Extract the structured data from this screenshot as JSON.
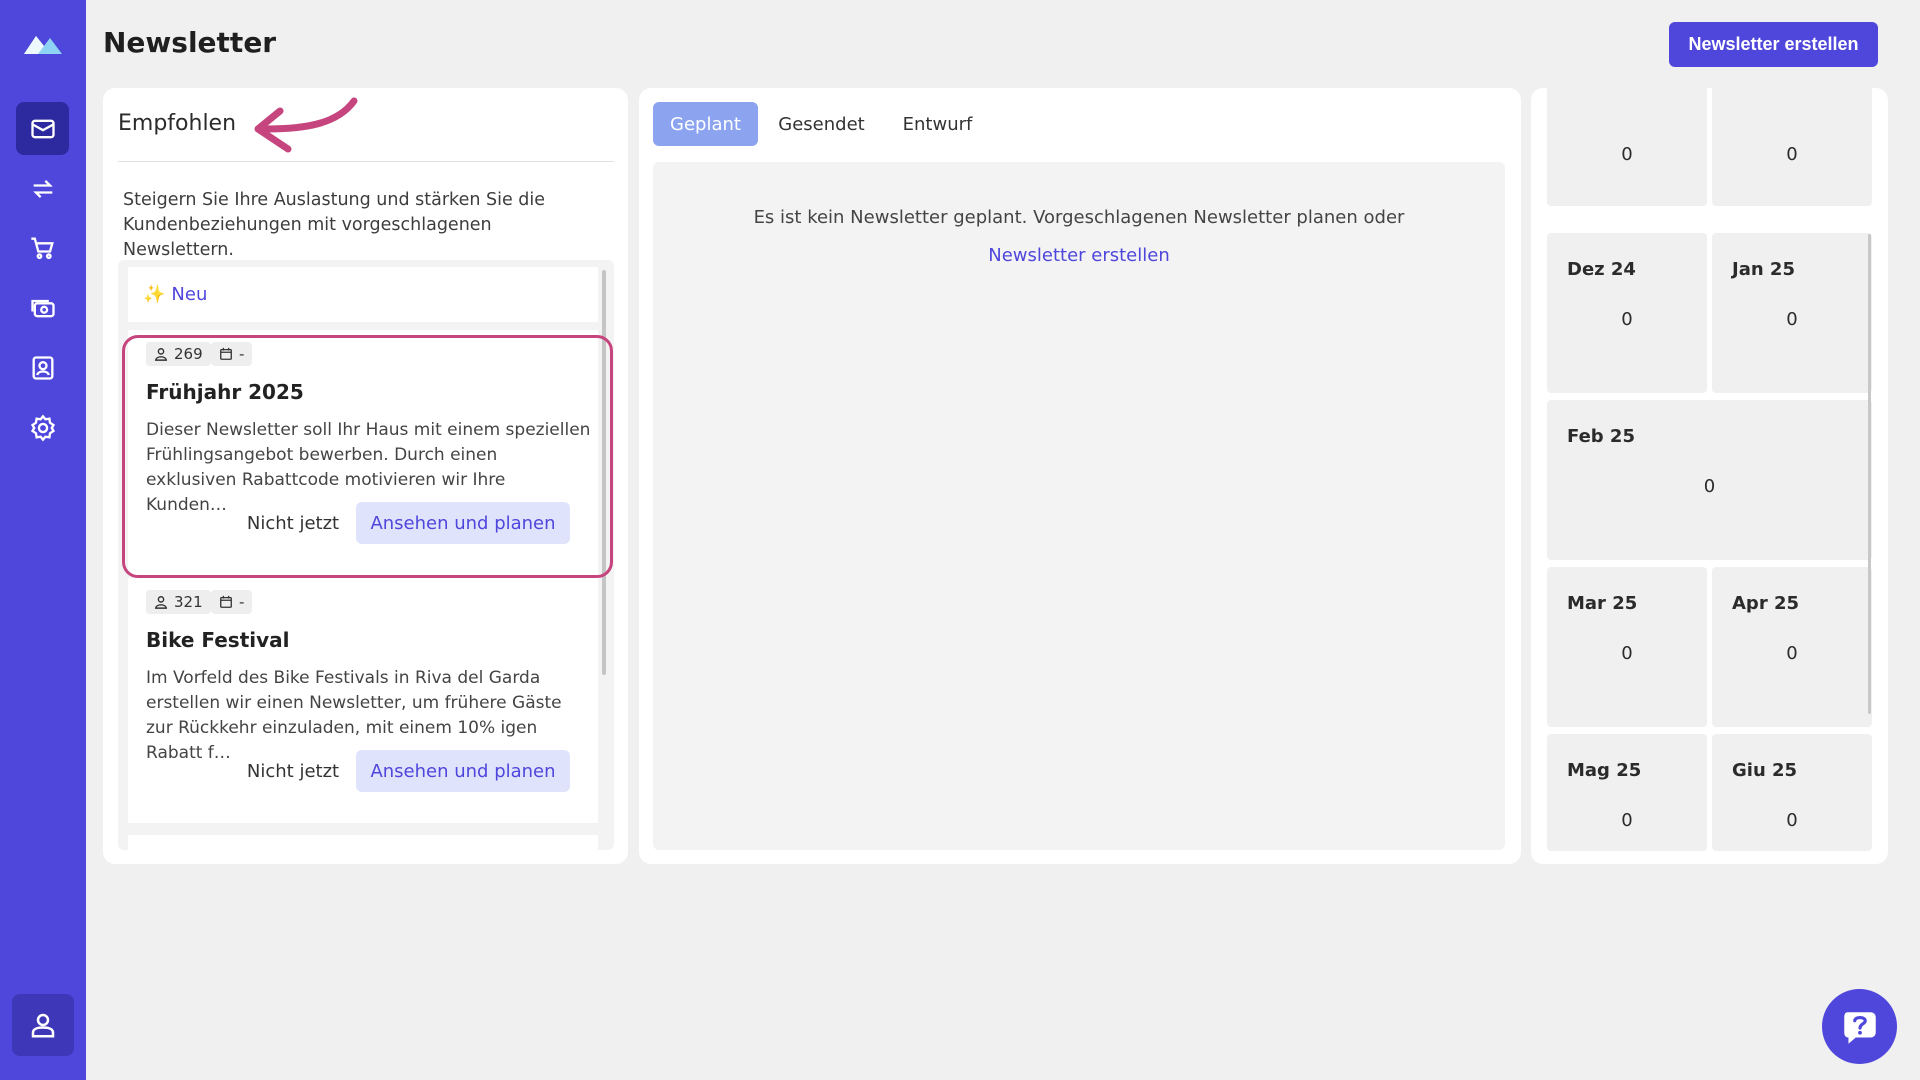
{
  "page": {
    "title": "Newsletter",
    "create_button": "Newsletter erstellen"
  },
  "sidebar": {
    "items": [
      {
        "icon": "mail-icon",
        "active": true
      },
      {
        "icon": "sync-icon",
        "active": false
      },
      {
        "icon": "cart-icon",
        "active": false
      },
      {
        "icon": "money-icon",
        "active": false
      },
      {
        "icon": "contact-icon",
        "active": false
      },
      {
        "icon": "settings-icon",
        "active": false
      }
    ],
    "user_icon": "user-icon"
  },
  "recommended": {
    "title": "Empfohlen",
    "description": "Steigern Sie Ihre Auslastung und stärken Sie die Kundenbeziehungen mit vorgeschlagenen Newslettern.",
    "new_label": "Neu",
    "cards": [
      {
        "recipients": "269",
        "date": "-",
        "title": "Frühjahr 2025",
        "text": "Dieser Newsletter soll Ihr Haus mit einem speziellen Frühlingsangebot bewerben. Durch einen exklusiven Rabattcode motivieren wir Ihre Kunden…",
        "dismiss": "Nicht jetzt",
        "plan": "Ansehen und planen"
      },
      {
        "recipients": "321",
        "date": "-",
        "title": "Bike Festival",
        "text": "Im Vorfeld des Bike Festivals in Riva del Garda erstellen wir einen Newsletter, um frühere Gäste zur Rückkehr einzuladen, mit einem 10% igen Rabatt f…",
        "dismiss": "Nicht jetzt",
        "plan": "Ansehen und planen"
      }
    ]
  },
  "tabs": [
    {
      "label": "Geplant",
      "active": true
    },
    {
      "label": "Gesendet",
      "active": false
    },
    {
      "label": "Entwurf",
      "active": false
    }
  ],
  "empty_state": {
    "text": "Es ist kein Newsletter geplant. Vorgeschlagenen Newsletter planen oder",
    "link": "Newsletter erstellen"
  },
  "calendar": {
    "top_counts": [
      "0",
      "0"
    ],
    "months": [
      {
        "label": "Dez 24",
        "count": "0"
      },
      {
        "label": "Jan 25",
        "count": "0"
      },
      {
        "label": "Feb 25",
        "count": "0"
      },
      {
        "label": "Mar 25",
        "count": "0"
      },
      {
        "label": "Apr 25",
        "count": "0"
      },
      {
        "label": "Mag 25",
        "count": "0"
      },
      {
        "label": "Giu 25",
        "count": "0"
      }
    ]
  },
  "colors": {
    "brand": "#4f46dc",
    "highlight": "#c6457e",
    "tab_active": "#8ca4f0"
  }
}
